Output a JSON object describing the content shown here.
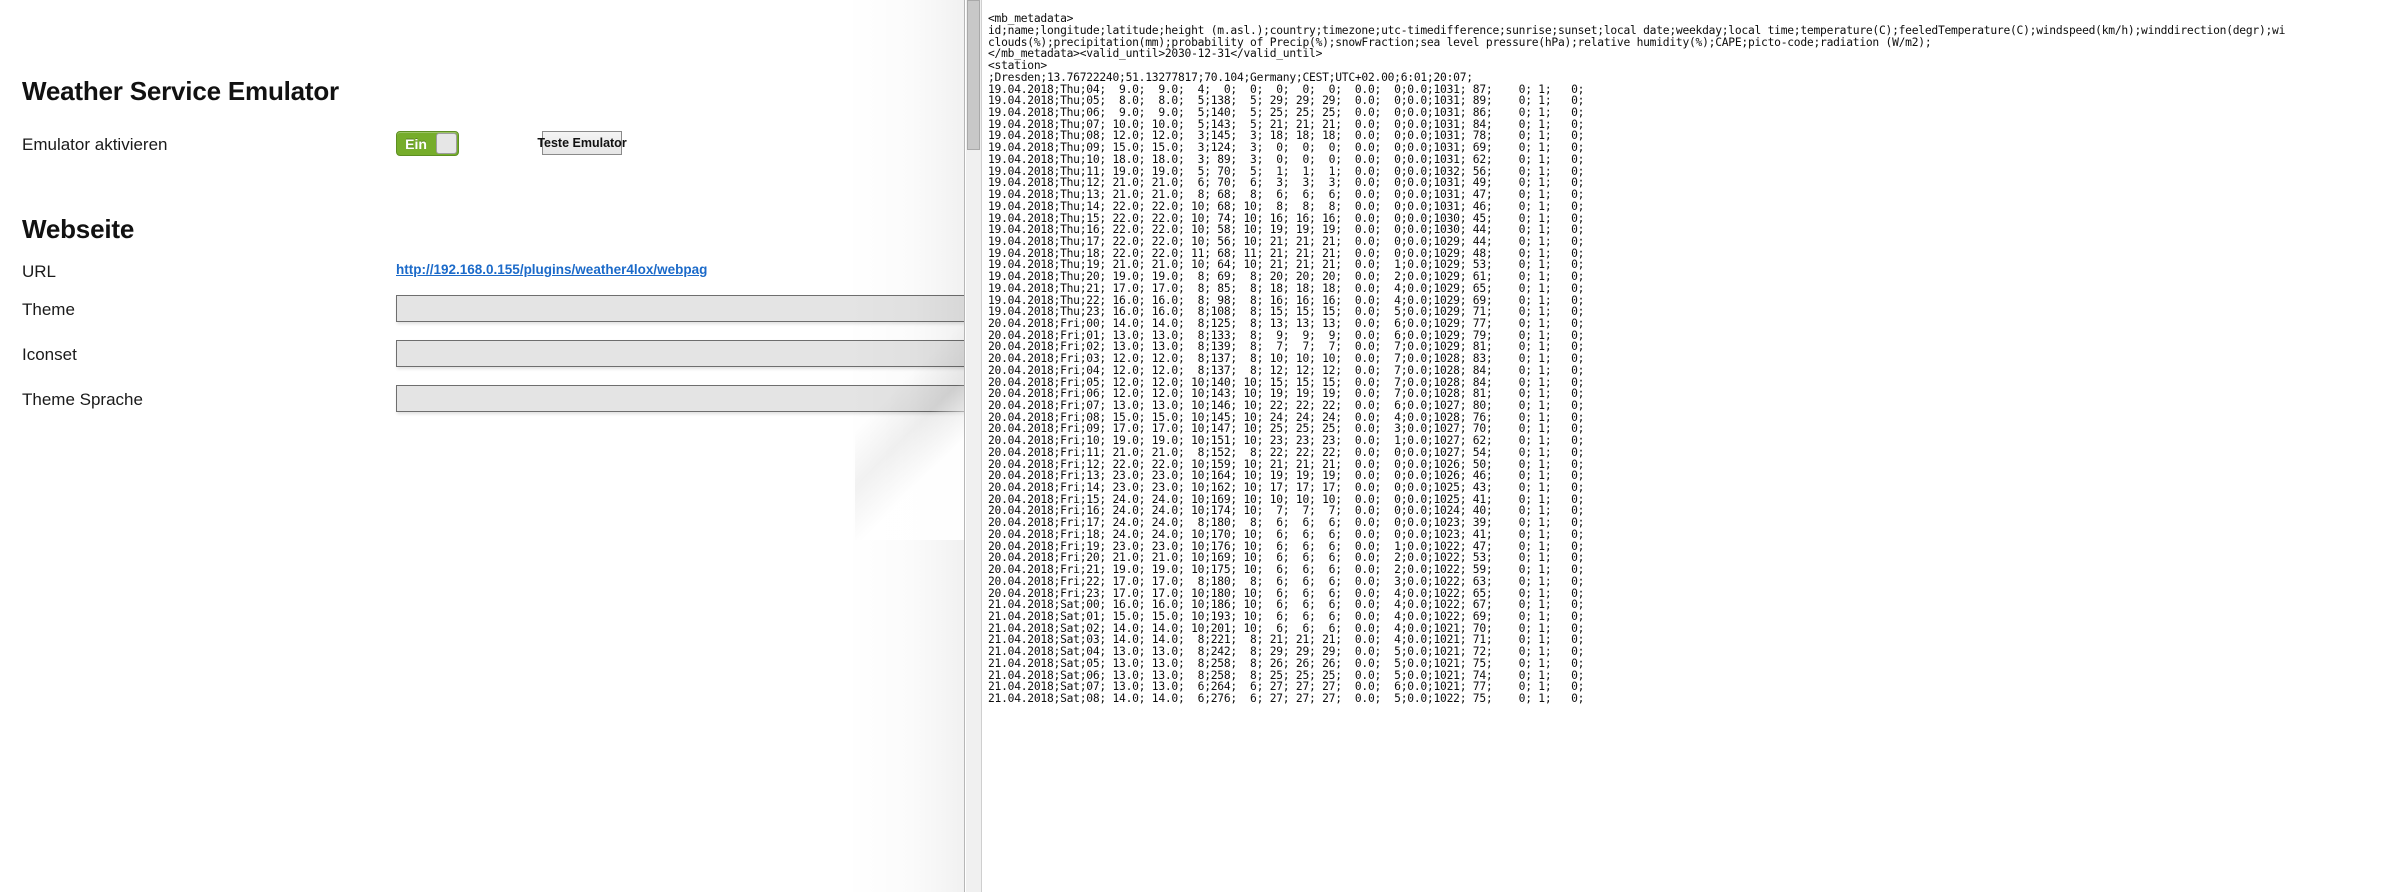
{
  "config": {
    "emulator": {
      "title": "Weather Service Emulator",
      "activate_label": "Emulator aktivieren",
      "toggle_value": "Ein",
      "test_button_label": "Teste Emulator"
    },
    "website": {
      "title": "Webseite",
      "fields": [
        {
          "label": "URL",
          "type": "link",
          "value": "http://192.168.0.155/plugins/weather4lox/webpag"
        },
        {
          "label": "Theme",
          "type": "select",
          "value": ""
        },
        {
          "label": "Iconset",
          "type": "select",
          "value": ""
        },
        {
          "label": "Theme Sprache",
          "type": "select",
          "value": ""
        }
      ]
    },
    "colors": {
      "toggle_on": "#76ad2b",
      "link": "#1b6ac9",
      "field_bg": "#e4e4e4"
    }
  },
  "data_panel": {
    "metadata_open_tag": "<mb_metadata>",
    "metadata_header_line1": "id;name;longitude;latitude;height (m.asl.);country;timezone;utc-timedifference;sunrise;sunset;local date;weekday;local time;temperature(C);feeledTemperature(C);windspeed(km/h);winddirection(degr);wi",
    "metadata_header_line2": "clouds(%);precipitation(mm);probability of Precip(%);snowFraction;sea level pressure(hPa);relative humidity(%);CAPE;picto-code;radiation (W/m2);",
    "metadata_close_line": "</mb_metadata><valid_until>2030-12-31</valid_until>",
    "station_open_tag": "<station>",
    "station_line": ";Dresden;13.76722240;51.13277817;70.104;Germany;CEST;UTC+02.00;6:01;20:07;",
    "rows": [
      "19.04.2018;Thu;04;  9.0;  9.0;  4;  0;  0;  0;  0;  0;  0.0;  0;0.0;1031; 87;    0; 1;   0;",
      "19.04.2018;Thu;05;  8.0;  8.0;  5;138;  5; 29; 29; 29;  0.0;  0;0.0;1031; 89;    0; 1;   0;",
      "19.04.2018;Thu;06;  9.0;  9.0;  5;140;  5; 25; 25; 25;  0.0;  0;0.0;1031; 86;    0; 1;   0;",
      "19.04.2018;Thu;07; 10.0; 10.0;  5;143;  5; 21; 21; 21;  0.0;  0;0.0;1031; 84;    0; 1;   0;",
      "19.04.2018;Thu;08; 12.0; 12.0;  3;145;  3; 18; 18; 18;  0.0;  0;0.0;1031; 78;    0; 1;   0;",
      "19.04.2018;Thu;09; 15.0; 15.0;  3;124;  3;  0;  0;  0;  0.0;  0;0.0;1031; 69;    0; 1;   0;",
      "19.04.2018;Thu;10; 18.0; 18.0;  3; 89;  3;  0;  0;  0;  0.0;  0;0.0;1031; 62;    0; 1;   0;",
      "19.04.2018;Thu;11; 19.0; 19.0;  5; 70;  5;  1;  1;  1;  0.0;  0;0.0;1032; 56;    0; 1;   0;",
      "19.04.2018;Thu;12; 21.0; 21.0;  6; 70;  6;  3;  3;  3;  0.0;  0;0.0;1031; 49;    0; 1;   0;",
      "19.04.2018;Thu;13; 21.0; 21.0;  8; 68;  8;  6;  6;  6;  0.0;  0;0.0;1031; 47;    0; 1;   0;",
      "19.04.2018;Thu;14; 22.0; 22.0; 10; 68; 10;  8;  8;  8;  0.0;  0;0.0;1031; 46;    0; 1;   0;",
      "19.04.2018;Thu;15; 22.0; 22.0; 10; 74; 10; 16; 16; 16;  0.0;  0;0.0;1030; 45;    0; 1;   0;",
      "19.04.2018;Thu;16; 22.0; 22.0; 10; 58; 10; 19; 19; 19;  0.0;  0;0.0;1030; 44;    0; 1;   0;",
      "19.04.2018;Thu;17; 22.0; 22.0; 10; 56; 10; 21; 21; 21;  0.0;  0;0.0;1029; 44;    0; 1;   0;",
      "19.04.2018;Thu;18; 22.0; 22.0; 11; 68; 11; 21; 21; 21;  0.0;  0;0.0;1029; 48;    0; 1;   0;",
      "19.04.2018;Thu;19; 21.0; 21.0; 10; 64; 10; 21; 21; 21;  0.0;  1;0.0;1029; 53;    0; 1;   0;",
      "19.04.2018;Thu;20; 19.0; 19.0;  8; 69;  8; 20; 20; 20;  0.0;  2;0.0;1029; 61;    0; 1;   0;",
      "19.04.2018;Thu;21; 17.0; 17.0;  8; 85;  8; 18; 18; 18;  0.0;  4;0.0;1029; 65;    0; 1;   0;",
      "19.04.2018;Thu;22; 16.0; 16.0;  8; 98;  8; 16; 16; 16;  0.0;  4;0.0;1029; 69;    0; 1;   0;",
      "19.04.2018;Thu;23; 16.0; 16.0;  8;108;  8; 15; 15; 15;  0.0;  5;0.0;1029; 71;    0; 1;   0;",
      "20.04.2018;Fri;00; 14.0; 14.0;  8;125;  8; 13; 13; 13;  0.0;  6;0.0;1029; 77;    0; 1;   0;",
      "20.04.2018;Fri;01; 13.0; 13.0;  8;133;  8;  9;  9;  9;  0.0;  6;0.0;1029; 79;    0; 1;   0;",
      "20.04.2018;Fri;02; 13.0; 13.0;  8;139;  8;  7;  7;  7;  0.0;  7;0.0;1029; 81;    0; 1;   0;",
      "20.04.2018;Fri;03; 12.0; 12.0;  8;137;  8; 10; 10; 10;  0.0;  7;0.0;1028; 83;    0; 1;   0;",
      "20.04.2018;Fri;04; 12.0; 12.0;  8;137;  8; 12; 12; 12;  0.0;  7;0.0;1028; 84;    0; 1;   0;",
      "20.04.2018;Fri;05; 12.0; 12.0; 10;140; 10; 15; 15; 15;  0.0;  7;0.0;1028; 84;    0; 1;   0;",
      "20.04.2018;Fri;06; 12.0; 12.0; 10;143; 10; 19; 19; 19;  0.0;  7;0.0;1028; 81;    0; 1;   0;",
      "20.04.2018;Fri;07; 13.0; 13.0; 10;146; 10; 22; 22; 22;  0.0;  6;0.0;1027; 80;    0; 1;   0;",
      "20.04.2018;Fri;08; 15.0; 15.0; 10;145; 10; 24; 24; 24;  0.0;  4;0.0;1028; 76;    0; 1;   0;",
      "20.04.2018;Fri;09; 17.0; 17.0; 10;147; 10; 25; 25; 25;  0.0;  3;0.0;1027; 70;    0; 1;   0;",
      "20.04.2018;Fri;10; 19.0; 19.0; 10;151; 10; 23; 23; 23;  0.0;  1;0.0;1027; 62;    0; 1;   0;",
      "20.04.2018;Fri;11; 21.0; 21.0;  8;152;  8; 22; 22; 22;  0.0;  0;0.0;1027; 54;    0; 1;   0;",
      "20.04.2018;Fri;12; 22.0; 22.0; 10;159; 10; 21; 21; 21;  0.0;  0;0.0;1026; 50;    0; 1;   0;",
      "20.04.2018;Fri;13; 23.0; 23.0; 10;164; 10; 19; 19; 19;  0.0;  0;0.0;1026; 46;    0; 1;   0;",
      "20.04.2018;Fri;14; 23.0; 23.0; 10;162; 10; 17; 17; 17;  0.0;  0;0.0;1025; 43;    0; 1;   0;",
      "20.04.2018;Fri;15; 24.0; 24.0; 10;169; 10; 10; 10; 10;  0.0;  0;0.0;1025; 41;    0; 1;   0;",
      "20.04.2018;Fri;16; 24.0; 24.0; 10;174; 10;  7;  7;  7;  0.0;  0;0.0;1024; 40;    0; 1;   0;",
      "20.04.2018;Fri;17; 24.0; 24.0;  8;180;  8;  6;  6;  6;  0.0;  0;0.0;1023; 39;    0; 1;   0;",
      "20.04.2018;Fri;18; 24.0; 24.0; 10;170; 10;  6;  6;  6;  0.0;  0;0.0;1023; 41;    0; 1;   0;",
      "20.04.2018;Fri;19; 23.0; 23.0; 10;176; 10;  6;  6;  6;  0.0;  1;0.0;1022; 47;    0; 1;   0;",
      "20.04.2018;Fri;20; 21.0; 21.0; 10;169; 10;  6;  6;  6;  0.0;  2;0.0;1022; 53;    0; 1;   0;",
      "20.04.2018;Fri;21; 19.0; 19.0; 10;175; 10;  6;  6;  6;  0.0;  2;0.0;1022; 59;    0; 1;   0;",
      "20.04.2018;Fri;22; 17.0; 17.0;  8;180;  8;  6;  6;  6;  0.0;  3;0.0;1022; 63;    0; 1;   0;",
      "20.04.2018;Fri;23; 17.0; 17.0; 10;180; 10;  6;  6;  6;  0.0;  4;0.0;1022; 65;    0; 1;   0;",
      "21.04.2018;Sat;00; 16.0; 16.0; 10;186; 10;  6;  6;  6;  0.0;  4;0.0;1022; 67;    0; 1;   0;",
      "21.04.2018;Sat;01; 15.0; 15.0; 10;193; 10;  6;  6;  6;  0.0;  4;0.0;1022; 69;    0; 1;   0;",
      "21.04.2018;Sat;02; 14.0; 14.0; 10;201; 10;  6;  6;  6;  0.0;  4;0.0;1021; 70;    0; 1;   0;",
      "21.04.2018;Sat;03; 14.0; 14.0;  8;221;  8; 21; 21; 21;  0.0;  4;0.0;1021; 71;    0; 1;   0;",
      "21.04.2018;Sat;04; 13.0; 13.0;  8;242;  8; 29; 29; 29;  0.0;  5;0.0;1021; 72;    0; 1;   0;",
      "21.04.2018;Sat;05; 13.0; 13.0;  8;258;  8; 26; 26; 26;  0.0;  5;0.0;1021; 75;    0; 1;   0;",
      "21.04.2018;Sat;06; 13.0; 13.0;  8;258;  8; 25; 25; 25;  0.0;  5;0.0;1021; 74;    0; 1;   0;",
      "21.04.2018;Sat;07; 13.0; 13.0;  6;264;  6; 27; 27; 27;  0.0;  6;0.0;1021; 77;    0; 1;   0;",
      "21.04.2018;Sat;08; 14.0; 14.0;  6;276;  6; 27; 27; 27;  0.0;  5;0.0;1022; 75;    0; 1;   0;"
    ]
  }
}
